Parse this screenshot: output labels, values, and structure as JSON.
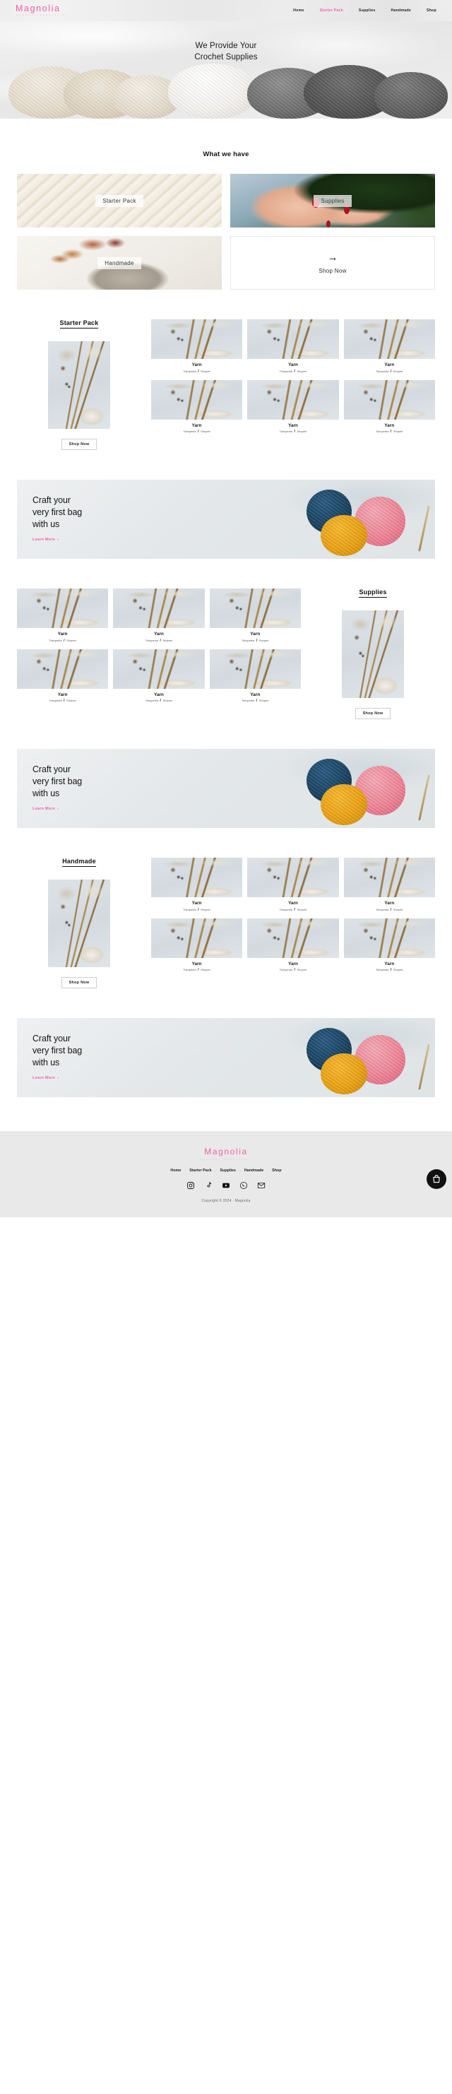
{
  "brand": {
    "name": "Magnolia",
    "tagline": "CROCHET SPECIALIST",
    "accent_color": "#f25fa8"
  },
  "nav": {
    "items": [
      {
        "label": "Home",
        "active": false
      },
      {
        "label": "Starter Pack",
        "active": true
      },
      {
        "label": "Supplies",
        "active": false
      },
      {
        "label": "Handmade",
        "active": false
      },
      {
        "label": "Shop",
        "active": false
      }
    ]
  },
  "hero": {
    "line1": "We Provide Your",
    "line2": "Crochet Supplies"
  },
  "what_we_have": {
    "title": "What we have",
    "cards": [
      {
        "label": "Starter Pack"
      },
      {
        "label": "Supplies"
      },
      {
        "label": "Handmade"
      }
    ],
    "shop_now": {
      "label": "Shop Now",
      "icon": "arrow-right-icon"
    }
  },
  "sections": [
    {
      "heading": "Starter Pack",
      "button": "Shop Now",
      "products": [
        {
          "name": "Yarn",
          "shop1": "Tokopedia",
          "sep": "/",
          "shop2": "Shopee"
        },
        {
          "name": "Yarn",
          "shop1": "Tokopedia",
          "sep": "/",
          "shop2": "Shopee"
        },
        {
          "name": "Yarn",
          "shop1": "Tokopedia",
          "sep": "/",
          "shop2": "Shopee"
        },
        {
          "name": "Yarn",
          "shop1": "Tokopedia",
          "sep": "/",
          "shop2": "Shopee"
        },
        {
          "name": "Yarn",
          "shop1": "Tokopedia",
          "sep": "/",
          "shop2": "Shopee"
        },
        {
          "name": "Yarn",
          "shop1": "Tokopedia",
          "sep": "/",
          "shop2": "Shopee"
        }
      ]
    },
    {
      "heading": "Supplies",
      "button": "Shop Now",
      "products": [
        {
          "name": "Yarn",
          "shop1": "Tokopedia",
          "sep": "/",
          "shop2": "Shopee"
        },
        {
          "name": "Yarn",
          "shop1": "Tokopedia",
          "sep": "/",
          "shop2": "Shopee"
        },
        {
          "name": "Yarn",
          "shop1": "Tokopedia",
          "sep": "/",
          "shop2": "Shopee"
        },
        {
          "name": "Yarn",
          "shop1": "Tokopedia",
          "sep": "/",
          "shop2": "Shopee"
        },
        {
          "name": "Yarn",
          "shop1": "Tokopedia",
          "sep": "/",
          "shop2": "Shopee"
        },
        {
          "name": "Yarn",
          "shop1": "Tokopedia",
          "sep": "/",
          "shop2": "Shopee"
        }
      ]
    },
    {
      "heading": "Handmade",
      "button": "Shop Now",
      "products": [
        {
          "name": "Yarn",
          "shop1": "Tokopedia",
          "sep": "/",
          "shop2": "Shopee"
        },
        {
          "name": "Yarn",
          "shop1": "Tokopedia",
          "sep": "/",
          "shop2": "Shopee"
        },
        {
          "name": "Yarn",
          "shop1": "Tokopedia",
          "sep": "/",
          "shop2": "Shopee"
        },
        {
          "name": "Yarn",
          "shop1": "Tokopedia",
          "sep": "/",
          "shop2": "Shopee"
        },
        {
          "name": "Yarn",
          "shop1": "Tokopedia",
          "sep": "/",
          "shop2": "Shopee"
        },
        {
          "name": "Yarn",
          "shop1": "Tokopedia",
          "sep": "/",
          "shop2": "Shopee"
        }
      ]
    }
  ],
  "cta": {
    "line1": "Craft your",
    "line2": "very first bag",
    "line3": "with us",
    "link": "Learn More",
    "link_arrow": "›"
  },
  "footer": {
    "nav": [
      "Home",
      "Starter Pack",
      "Supplies",
      "Handmade",
      "Shop"
    ],
    "separator": "·",
    "socials": [
      "instagram-icon",
      "tiktok-icon",
      "youtube-icon",
      "whatsapp-icon",
      "email-icon"
    ],
    "copyright": "Copyright © 2024 · Magnolia"
  },
  "cart": {
    "icon": "shopping-bag-icon"
  }
}
